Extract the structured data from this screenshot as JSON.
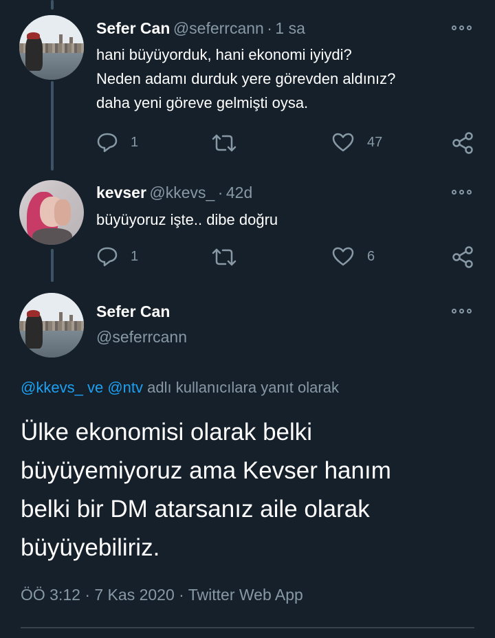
{
  "tweets": [
    {
      "name": "Sefer Can",
      "handle": "@seferrcann",
      "separator": "·",
      "time": "1 sa",
      "lines": [
        "hani büyüyorduk, hani ekonomi iyiydi?",
        "Neden adamı durduk yere görevden aldınız?",
        "daha yeni göreve gelmişti oysa."
      ],
      "reply_count": "1",
      "like_count": "47"
    },
    {
      "name": "kevser",
      "handle": "@kkevs_",
      "separator": "·",
      "time": "42d",
      "lines": [
        "büyüyoruz işte.. dibe doğru"
      ],
      "reply_count": "1",
      "like_count": "6"
    }
  ],
  "main_tweet": {
    "name": "Sefer Can",
    "handle": "@seferrcann",
    "reply_to": {
      "user1": "@kkevs_",
      "conj": "ve",
      "user2": "@ntv",
      "suffix": "adlı kullanıcılara yanıt olarak"
    },
    "lines": [
      "Ülke ekonomisi olarak belki",
      "büyüyemiyoruz ama Kevser hanım",
      "belki bir DM atarsanız aile olarak",
      "büyüyebiliriz."
    ],
    "timestamp": "ÖÖ 3:12 · 7 Kas 2020 · Twitter Web App"
  },
  "icons": {
    "reply": "reply-icon",
    "retweet": "retweet-icon",
    "like": "heart-icon",
    "share": "share-icon",
    "more": "more-icon"
  },
  "colors": {
    "background": "#15202b",
    "secondary_text": "#8899a6",
    "link": "#1da1f2",
    "thread_line": "#3d5466",
    "divider": "#38444d"
  }
}
